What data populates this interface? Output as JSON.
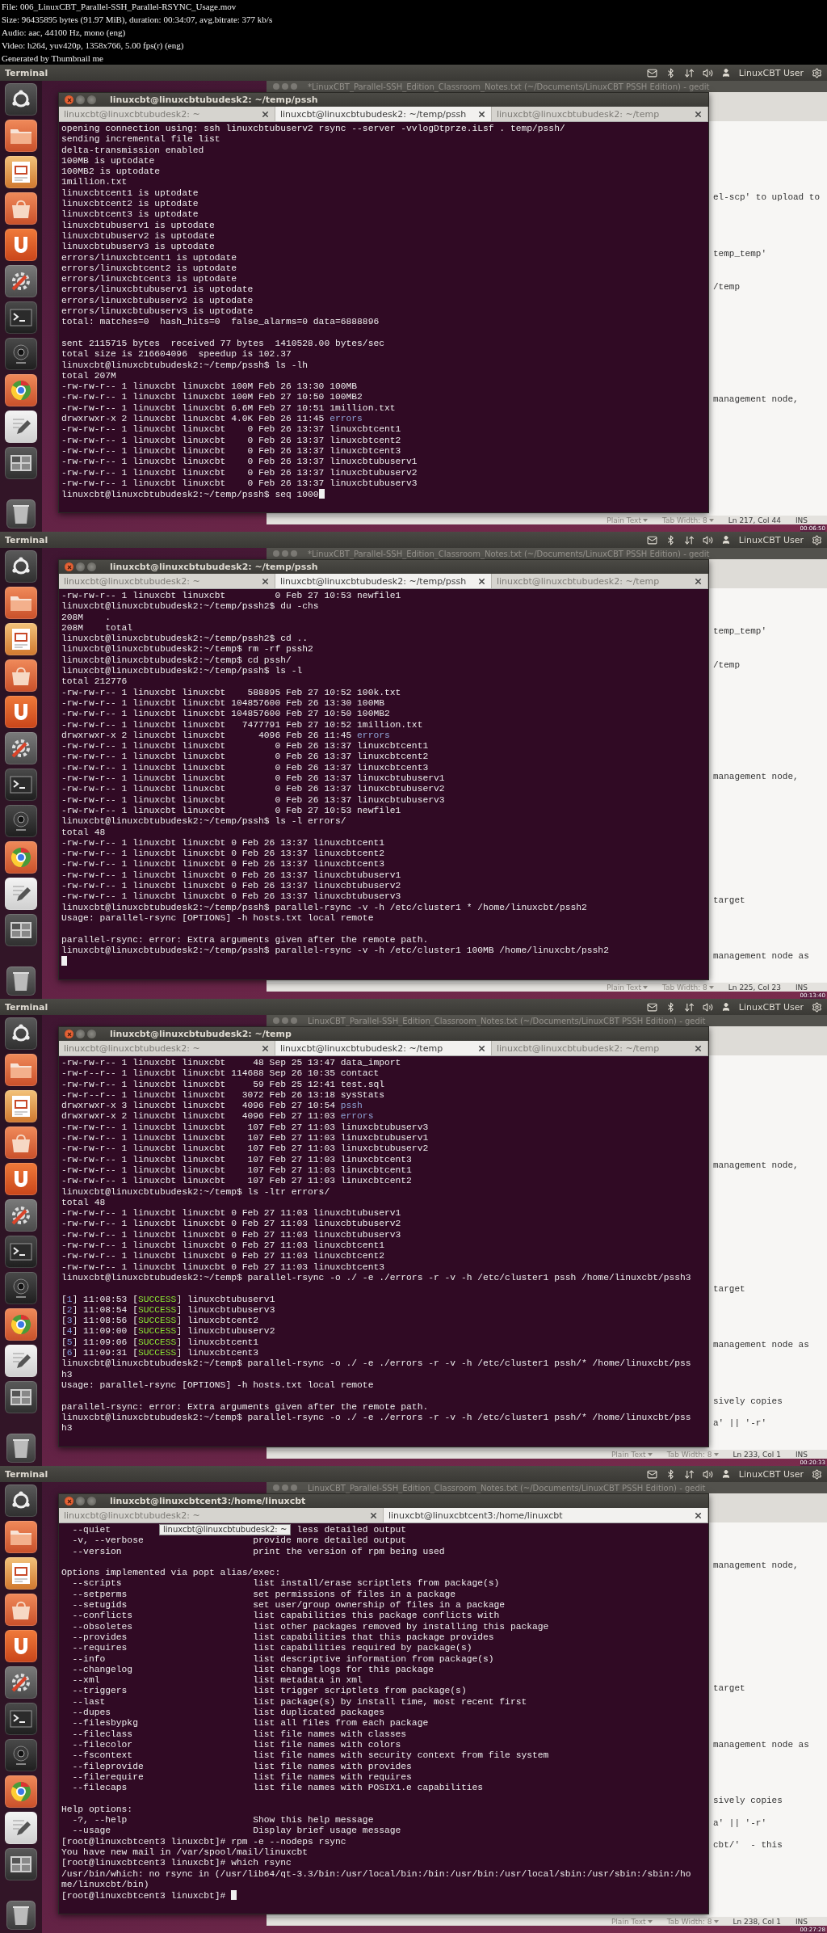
{
  "video_info": [
    "File: 006_LinuxCBT_Parallel-SSH_Parallel-RSYNC_Usage.mov",
    "Size: 96435895 bytes (91.97 MiB), duration: 00:34:07, avg.bitrate: 377 kb/s",
    "Audio: aac, 44100 Hz, mono (eng)",
    "Video: h264, yuv420p, 1358x766, 5.00 fps(r) (eng)",
    "Generated by Thumbnail me"
  ],
  "frames": [
    {
      "panel": {
        "app_name": "Terminal",
        "user": "LinuxCBT User"
      },
      "gedit": {
        "title": "*LinuxCBT_Parallel-SSH_Edition_Classroom_Notes.txt (~/Documents/LinuxCBT PSSH Edition) - gedit",
        "lines": [
          "el-scp' to upload to",
          "temp_temp'",
          "/temp",
          "management node,"
        ],
        "status": {
          "language": "Plain Text",
          "tab_width": "Tab Width: 8",
          "position": "Ln 217, Col 44",
          "mode": "INS"
        }
      },
      "terminal": {
        "title": "linuxcbt@linuxcbtubudesk2: ~/temp/pssh",
        "tabs": [
          {
            "label": "linuxcbt@linuxcbtubudesk2: ~",
            "selected": false
          },
          {
            "label": "linuxcbt@linuxcbtubudesk2: ~/temp/pssh",
            "selected": true
          },
          {
            "label": "linuxcbt@linuxcbtubudesk2: ~/temp",
            "selected": false
          }
        ],
        "lines": [
          "opening connection using: ssh linuxcbtubuserv2 rsync --server -vvlogDtprze.iLsf . temp/pssh/",
          "sending incremental file list",
          "delta-transmission enabled",
          "100MB is uptodate",
          "100MB2 is uptodate",
          "1million.txt",
          "linuxcbtcent1 is uptodate",
          "linuxcbtcent2 is uptodate",
          "linuxcbtcent3 is uptodate",
          "linuxcbtubuserv1 is uptodate",
          "linuxcbtubuserv2 is uptodate",
          "linuxcbtubuserv3 is uptodate",
          "errors/linuxcbtcent1 is uptodate",
          "errors/linuxcbtcent2 is uptodate",
          "errors/linuxcbtcent3 is uptodate",
          "errors/linuxcbtubuserv1 is uptodate",
          "errors/linuxcbtubuserv2 is uptodate",
          "errors/linuxcbtubuserv3 is uptodate",
          "total: matches=0  hash_hits=0  false_alarms=0 data=6888896",
          {
            "kind": "blank"
          },
          "sent 2115715 bytes  received 77 bytes  1410528.00 bytes/sec",
          "total size is 216604096  speedup is 102.37",
          "linuxcbt@linuxcbtubudesk2:~/temp/pssh$ ls -lh",
          "total 207M",
          "-rw-rw-r-- 1 linuxcbt linuxcbt 100M Feb 26 13:30 100MB",
          "-rw-rw-r-- 1 linuxcbt linuxcbt 100M Feb 27 10:50 100MB2",
          "-rw-rw-r-- 1 linuxcbt linuxcbt 6.6M Feb 27 10:51 1million.txt",
          {
            "kind": "segments",
            "parts": [
              "drwxrwxr-x 2 linuxcbt linuxcbt 4.0K Feb 26 11:45 ",
              {
                "text": "errors",
                "kind": "dir"
              }
            ]
          },
          "-rw-rw-r-- 1 linuxcbt linuxcbt    0 Feb 26 13:37 linuxcbtcent1",
          "-rw-rw-r-- 1 linuxcbt linuxcbt    0 Feb 26 13:37 linuxcbtcent2",
          "-rw-rw-r-- 1 linuxcbt linuxcbt    0 Feb 26 13:37 linuxcbtcent3",
          "-rw-rw-r-- 1 linuxcbt linuxcbt    0 Feb 26 13:37 linuxcbtubuserv1",
          "-rw-rw-r-- 1 linuxcbt linuxcbt    0 Feb 26 13:37 linuxcbtubuserv2",
          "-rw-rw-r-- 1 linuxcbt linuxcbt    0 Feb 26 13:37 linuxcbtubuserv3",
          "linuxcbt@linuxcbtubudesk2:~/temp/pssh$ seq 1000"
        ],
        "cursor": true
      },
      "timestamp": "00:06:50"
    },
    {
      "panel": {
        "app_name": "Terminal",
        "user": "LinuxCBT User"
      },
      "gedit": {
        "title": "*LinuxCBT_Parallel-SSH_Edition_Classroom_Notes.txt (~/Documents/LinuxCBT PSSH Edition) - gedit",
        "lines": [
          "temp_temp'",
          "/temp",
          "management node,",
          "target",
          "management node as"
        ],
        "status": {
          "language": "Plain Text",
          "tab_width": "Tab Width: 8",
          "position": "Ln 225, Col 23",
          "mode": "INS"
        }
      },
      "terminal": {
        "title": "linuxcbt@linuxcbtubudesk2: ~/temp/pssh",
        "tabs": [
          {
            "label": "linuxcbt@linuxcbtubudesk2: ~",
            "selected": false
          },
          {
            "label": "linuxcbt@linuxcbtubudesk2: ~/temp/pssh",
            "selected": true
          },
          {
            "label": "linuxcbt@linuxcbtubudesk2: ~/temp",
            "selected": false
          }
        ],
        "lines": [
          "-rw-rw-r-- 1 linuxcbt linuxcbt         0 Feb 27 10:53 newfile1",
          "linuxcbt@linuxcbtubudesk2:~/temp/pssh2$ du -chs",
          "208M\t.",
          "208M\ttotal",
          "linuxcbt@linuxcbtubudesk2:~/temp/pssh2$ cd ..",
          "linuxcbt@linuxcbtubudesk2:~/temp$ rm -rf pssh2",
          "linuxcbt@linuxcbtubudesk2:~/temp$ cd pssh/",
          "linuxcbt@linuxcbtubudesk2:~/temp/pssh$ ls -l",
          "total 212776",
          "-rw-rw-r-- 1 linuxcbt linuxcbt    588895 Feb 27 10:52 100k.txt",
          "-rw-rw-r-- 1 linuxcbt linuxcbt 104857600 Feb 26 13:30 100MB",
          "-rw-rw-r-- 1 linuxcbt linuxcbt 104857600 Feb 27 10:50 100MB2",
          "-rw-rw-r-- 1 linuxcbt linuxcbt   7477791 Feb 27 10:52 1million.txt",
          {
            "kind": "segments",
            "parts": [
              "drwxrwxr-x 2 linuxcbt linuxcbt      4096 Feb 26 11:45 ",
              {
                "text": "errors",
                "kind": "dir"
              }
            ]
          },
          "-rw-rw-r-- 1 linuxcbt linuxcbt         0 Feb 26 13:37 linuxcbtcent1",
          "-rw-rw-r-- 1 linuxcbt linuxcbt         0 Feb 26 13:37 linuxcbtcent2",
          "-rw-rw-r-- 1 linuxcbt linuxcbt         0 Feb 26 13:37 linuxcbtcent3",
          "-rw-rw-r-- 1 linuxcbt linuxcbt         0 Feb 26 13:37 linuxcbtubuserv1",
          "-rw-rw-r-- 1 linuxcbt linuxcbt         0 Feb 26 13:37 linuxcbtubuserv2",
          "-rw-rw-r-- 1 linuxcbt linuxcbt         0 Feb 26 13:37 linuxcbtubuserv3",
          "-rw-rw-r-- 1 linuxcbt linuxcbt         0 Feb 27 10:53 newfile1",
          "linuxcbt@linuxcbtubudesk2:~/temp/pssh$ ls -l errors/",
          "total 48",
          "-rw-rw-r-- 1 linuxcbt linuxcbt 0 Feb 26 13:37 linuxcbtcent1",
          "-rw-rw-r-- 1 linuxcbt linuxcbt 0 Feb 26 13:37 linuxcbtcent2",
          "-rw-rw-r-- 1 linuxcbt linuxcbt 0 Feb 26 13:37 linuxcbtcent3",
          "-rw-rw-r-- 1 linuxcbt linuxcbt 0 Feb 26 13:37 linuxcbtubuserv1",
          "-rw-rw-r-- 1 linuxcbt linuxcbt 0 Feb 26 13:37 linuxcbtubuserv2",
          "-rw-rw-r-- 1 linuxcbt linuxcbt 0 Feb 26 13:37 linuxcbtubuserv3",
          "linuxcbt@linuxcbtubudesk2:~/temp/pssh$ parallel-rsync -v -h /etc/cluster1 * /home/linuxcbt/pssh2",
          "Usage: parallel-rsync [OPTIONS] -h hosts.txt local remote",
          {
            "kind": "blank"
          },
          "parallel-rsync: error: Extra arguments given after the remote path.",
          "linuxcbt@linuxcbtubudesk2:~/temp/pssh$ parallel-rsync -v -h /etc/cluster1 100MB /home/linuxcbt/pssh2",
          {
            "kind": "blank"
          }
        ],
        "cursor": true
      },
      "timestamp": "00:13:40"
    },
    {
      "panel": {
        "app_name": "Terminal",
        "user": "LinuxCBT User"
      },
      "gedit": {
        "title": "LinuxCBT_Parallel-SSH_Edition_Classroom_Notes.txt (~/Documents/LinuxCBT PSSH Edition) - gedit",
        "lines": [
          "management node,",
          "target",
          "management node as",
          "sively copies",
          "a' || '-r'"
        ],
        "status": {
          "language": "Plain Text",
          "tab_width": "Tab Width: 8",
          "position": "Ln 233, Col 1",
          "mode": "INS"
        }
      },
      "terminal": {
        "title": "linuxcbt@linuxcbtubudesk2: ~/temp",
        "tabs": [
          {
            "label": "linuxcbt@linuxcbtubudesk2: ~",
            "selected": false
          },
          {
            "label": "linuxcbt@linuxcbtubudesk2: ~/temp",
            "selected": true
          },
          {
            "label": "linuxcbt@linuxcbtubudesk2: ~/temp",
            "selected": false
          }
        ],
        "lines": [
          "-rw-rw-r-- 1 linuxcbt linuxcbt     48 Sep 25 13:47 data_import",
          "-rw-r--r-- 1 linuxcbt linuxcbt 114688 Sep 26 10:35 contact",
          "-rw-rw-r-- 1 linuxcbt linuxcbt     59 Feb 25 12:41 test.sql",
          "-rw-r--r-- 1 linuxcbt linuxcbt   3072 Feb 26 13:18 sysStats",
          {
            "kind": "segments",
            "parts": [
              "drwxrwxr-x 3 linuxcbt linuxcbt   4096 Feb 27 10:54 ",
              {
                "text": "pssh",
                "kind": "dir"
              }
            ]
          },
          {
            "kind": "segments",
            "parts": [
              "drwxrwxr-x 2 linuxcbt linuxcbt   4096 Feb 27 11:03 ",
              {
                "text": "errors",
                "kind": "dir"
              }
            ]
          },
          "-rw-rw-r-- 1 linuxcbt linuxcbt    107 Feb 27 11:03 linuxcbtubuserv3",
          "-rw-rw-r-- 1 linuxcbt linuxcbt    107 Feb 27 11:03 linuxcbtubuserv1",
          "-rw-rw-r-- 1 linuxcbt linuxcbt    107 Feb 27 11:03 linuxcbtubuserv2",
          "-rw-rw-r-- 1 linuxcbt linuxcbt    107 Feb 27 11:03 linuxcbtcent3",
          "-rw-rw-r-- 1 linuxcbt linuxcbt    107 Feb 27 11:03 linuxcbtcent1",
          "-rw-rw-r-- 1 linuxcbt linuxcbt    107 Feb 27 11:03 linuxcbtcent2",
          "linuxcbt@linuxcbtubudesk2:~/temp$ ls -ltr errors/",
          "total 48",
          "-rw-rw-r-- 1 linuxcbt linuxcbt 0 Feb 27 11:03 linuxcbtubuserv1",
          "-rw-rw-r-- 1 linuxcbt linuxcbt 0 Feb 27 11:03 linuxcbtubuserv2",
          "-rw-rw-r-- 1 linuxcbt linuxcbt 0 Feb 27 11:03 linuxcbtubuserv3",
          "-rw-rw-r-- 1 linuxcbt linuxcbt 0 Feb 27 11:03 linuxcbtcent1",
          "-rw-rw-r-- 1 linuxcbt linuxcbt 0 Feb 27 11:03 linuxcbtcent2",
          "-rw-rw-r-- 1 linuxcbt linuxcbt 0 Feb 27 11:03 linuxcbtcent3",
          "linuxcbt@linuxcbtubudesk2:~/temp$ parallel-rsync -o ./ -e ./errors -r -v -h /etc/cluster1 pssh /home/linuxcbt/pssh3",
          {
            "kind": "blank"
          },
          {
            "kind": "segments",
            "parts": [
              "[",
              {
                "text": "1",
                "kind": "num"
              },
              "] 11:08:53 [",
              {
                "text": "SUCCESS",
                "kind": "ok"
              },
              "] linuxcbtubuserv1"
            ]
          },
          {
            "kind": "segments",
            "parts": [
              "[",
              {
                "text": "2",
                "kind": "num"
              },
              "] 11:08:54 [",
              {
                "text": "SUCCESS",
                "kind": "ok"
              },
              "] linuxcbtubuserv3"
            ]
          },
          {
            "kind": "segments",
            "parts": [
              "[",
              {
                "text": "3",
                "kind": "num"
              },
              "] 11:08:56 [",
              {
                "text": "SUCCESS",
                "kind": "ok"
              },
              "] linuxcbtcent2"
            ]
          },
          {
            "kind": "segments",
            "parts": [
              "[",
              {
                "text": "4",
                "kind": "num"
              },
              "] 11:09:00 [",
              {
                "text": "SUCCESS",
                "kind": "ok"
              },
              "] linuxcbtubuserv2"
            ]
          },
          {
            "kind": "segments",
            "parts": [
              "[",
              {
                "text": "5",
                "kind": "num"
              },
              "] 11:09:06 [",
              {
                "text": "SUCCESS",
                "kind": "ok"
              },
              "] linuxcbtcent1"
            ]
          },
          {
            "kind": "segments",
            "parts": [
              "[",
              {
                "text": "6",
                "kind": "num"
              },
              "] 11:09:31 [",
              {
                "text": "SUCCESS",
                "kind": "ok"
              },
              "] linuxcbtcent3"
            ]
          },
          "linuxcbt@linuxcbtubudesk2:~/temp$ parallel-rsync -o ./ -e ./errors -r -v -h /etc/cluster1 pssh/* /home/linuxcbt/pss",
          "h3",
          "Usage: parallel-rsync [OPTIONS] -h hosts.txt local remote",
          {
            "kind": "blank"
          },
          "parallel-rsync: error: Extra arguments given after the remote path.",
          "linuxcbt@linuxcbtubudesk2:~/temp$ parallel-rsync -o ./ -e ./errors -r -v -h /etc/cluster1 pssh/* /home/linuxcbt/pss",
          "h3"
        ],
        "cursor": false
      },
      "timestamp": "00:20:33"
    },
    {
      "panel": {
        "app_name": "Terminal",
        "user": "LinuxCBT User"
      },
      "gedit": {
        "title": "LinuxCBT_Parallel-SSH_Edition_Classroom_Notes.txt (~/Documents/LinuxCBT PSSH Edition) - gedit",
        "lines": [
          "management node,",
          "target",
          "management node as",
          "sively copies",
          "a' || '-r'",
          "cbt/'  - this"
        ],
        "status": {
          "language": "Plain Text",
          "tab_width": "Tab Width: 8",
          "position": "Ln 238, Col 1",
          "mode": "INS"
        }
      },
      "terminal": {
        "title": "linuxcbt@linuxcbtcent3:/home/linuxcbt",
        "tabs": [
          {
            "label": "linuxcbt@linuxcbtubudesk2: ~",
            "selected": false
          },
          {
            "label": "linuxcbt@linuxcbtcent3:/home/linuxcbt",
            "selected": true
          }
        ],
        "tooltip": "linuxcbt@linuxcbtubudesk2: ~",
        "lines": [
          {
            "kind": "covered",
            "parts": [
              "  --quiet",
              "less detailed output"
            ]
          },
          "  -v, --verbose                    provide more detailed output",
          "  --version                        print the version of rpm being used",
          {
            "kind": "blank"
          },
          "Options implemented via popt alias/exec:",
          "  --scripts                        list install/erase scriptlets from package(s)",
          "  --setperms                       set permissions of files in a package",
          "  --setugids                       set user/group ownership of files in a package",
          "  --conflicts                      list capabilities this package conflicts with",
          "  --obsoletes                      list other packages removed by installing this package",
          "  --provides                       list capabilities that this package provides",
          "  --requires                       list capabilities required by package(s)",
          "  --info                           list descriptive information from package(s)",
          "  --changelog                      list change logs for this package",
          "  --xml                            list metadata in xml",
          "  --triggers                       list trigger scriptlets from package(s)",
          "  --last                           list package(s) by install time, most recent first",
          "  --dupes                          list duplicated packages",
          "  --filesbypkg                     list all files from each package",
          "  --fileclass                      list file names with classes",
          "  --filecolor                      list file names with colors",
          "  --fscontext                      list file names with security context from file system",
          "  --fileprovide                    list file names with provides",
          "  --filerequire                    list file names with requires",
          "  --filecaps                       list file names with POSIX1.e capabilities",
          {
            "kind": "blank"
          },
          "Help options:",
          "  -?, --help                       Show this help message",
          "  --usage                          Display brief usage message",
          "[root@linuxcbtcent3 linuxcbt]# rpm -e --nodeps rsync",
          "You have new mail in /var/spool/mail/linuxcbt",
          "[root@linuxcbtcent3 linuxcbt]# which rsync",
          "/usr/bin/which: no rsync in (/usr/lib64/qt-3.3/bin:/usr/local/bin:/bin:/usr/bin:/usr/local/sbin:/usr/sbin:/sbin:/ho",
          "me/linuxcbt/bin)",
          "[root@linuxcbtcent3 linuxcbt]# "
        ],
        "cursor": true
      },
      "timestamp": "00:27:28"
    }
  ]
}
